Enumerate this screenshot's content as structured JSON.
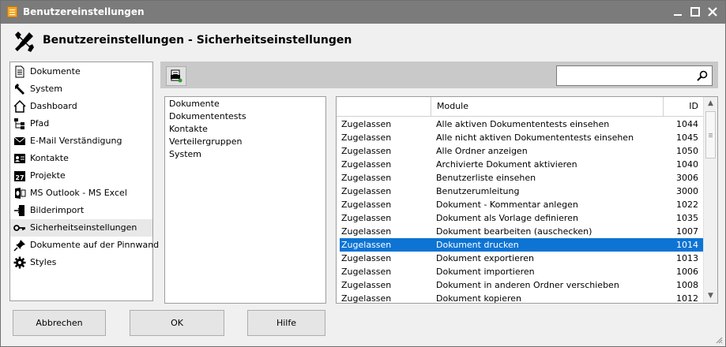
{
  "window": {
    "title": "Benutzereinstellungen"
  },
  "header": {
    "title": "Benutzereinstellungen - Sicherheitseinstellungen",
    "icon": "wrench-screwdriver-icon"
  },
  "sidebar": {
    "items": [
      {
        "label": "Dokumente",
        "icon": "document-icon"
      },
      {
        "label": "System",
        "icon": "wrench-icon"
      },
      {
        "label": "Dashboard",
        "icon": "home-icon"
      },
      {
        "label": "Pfad",
        "icon": "tree-icon"
      },
      {
        "label": "E-Mail Verständigung",
        "icon": "email-icon"
      },
      {
        "label": "Kontakte",
        "icon": "contact-card-icon"
      },
      {
        "label": "Projekte",
        "icon": "calendar-icon"
      },
      {
        "label": "MS Outlook - MS Excel",
        "icon": "outlook-icon"
      },
      {
        "label": "Bilderimport",
        "icon": "import-icon"
      },
      {
        "label": "Sicherheitseinstellungen",
        "icon": "key-icon",
        "selected": true
      },
      {
        "label": "Dokumente auf der Pinnwand",
        "icon": "pin-icon"
      },
      {
        "label": "Styles",
        "icon": "gear-icon"
      }
    ]
  },
  "toolbar": {
    "export_icon": "export-list-icon"
  },
  "search": {
    "value": "",
    "placeholder": "",
    "icon": "search-icon"
  },
  "groups": {
    "items": [
      "Dokumente",
      "Dokumententests",
      "Kontakte",
      "Verteilergruppen",
      "System"
    ]
  },
  "grid": {
    "columns": [
      "",
      "Module",
      "ID"
    ],
    "rows": [
      {
        "status": "Zugelassen",
        "module": "Alle aktiven Dokumententests einsehen",
        "id": "1044"
      },
      {
        "status": "Zugelassen",
        "module": "Alle nicht aktiven Dokumententests einsehen",
        "id": "1045"
      },
      {
        "status": "Zugelassen",
        "module": "Alle Ordner anzeigen",
        "id": "1050"
      },
      {
        "status": "Zugelassen",
        "module": "Archivierte Dokument aktivieren",
        "id": "1040"
      },
      {
        "status": "Zugelassen",
        "module": "Benutzerliste einsehen",
        "id": "3006"
      },
      {
        "status": "Zugelassen",
        "module": "Benutzerumleitung",
        "id": "3000"
      },
      {
        "status": "Zugelassen",
        "module": "Dokument - Kommentar anlegen",
        "id": "1022"
      },
      {
        "status": "Zugelassen",
        "module": "Dokument als Vorlage definieren",
        "id": "1035"
      },
      {
        "status": "Zugelassen",
        "module": "Dokument bearbeiten (auschecken)",
        "id": "1007"
      },
      {
        "status": "Zugelassen",
        "module": "Dokument drucken",
        "id": "1014",
        "selected": true
      },
      {
        "status": "Zugelassen",
        "module": "Dokument exportieren",
        "id": "1013"
      },
      {
        "status": "Zugelassen",
        "module": "Dokument importieren",
        "id": "1006"
      },
      {
        "status": "Zugelassen",
        "module": "Dokument in anderen Ordner verschieben",
        "id": "1008"
      },
      {
        "status": "Zugelassen",
        "module": "Dokument kopieren",
        "id": "1012"
      }
    ],
    "selection_color": "#0d74d4"
  },
  "buttons": {
    "cancel": "Abbrechen",
    "ok": "OK",
    "help": "Hilfe"
  },
  "colors": {
    "titlebar": "#7b7b7b",
    "toolbar": "#c9c9c9",
    "selected_row": "#0d74d4"
  }
}
